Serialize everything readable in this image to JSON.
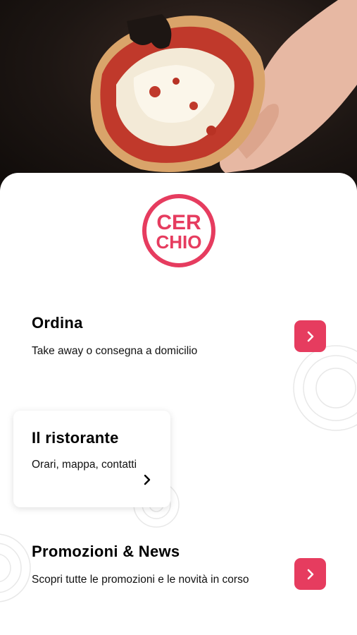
{
  "hero": {
    "image": "pizza-slice-in-hand"
  },
  "logo": {
    "line1": "CER",
    "line2": "CHIO",
    "color": "#e63c5f"
  },
  "menu": {
    "order": {
      "title": "Ordina",
      "description": "Take away o consegna a domicilio",
      "icon": "chevron-right-icon"
    },
    "restaurant": {
      "title": "Il ristorante",
      "description": "Orari, mappa, contatti",
      "icon": "chevron-right-icon"
    },
    "promotions": {
      "title": "Promozioni & News",
      "description": "Scopri tutte le promozioni e le novità in corso",
      "icon": "chevron-right-icon"
    }
  },
  "colors": {
    "accent": "#e63c5f",
    "background": "#ffffff",
    "hero_bg": "#1d1613"
  }
}
